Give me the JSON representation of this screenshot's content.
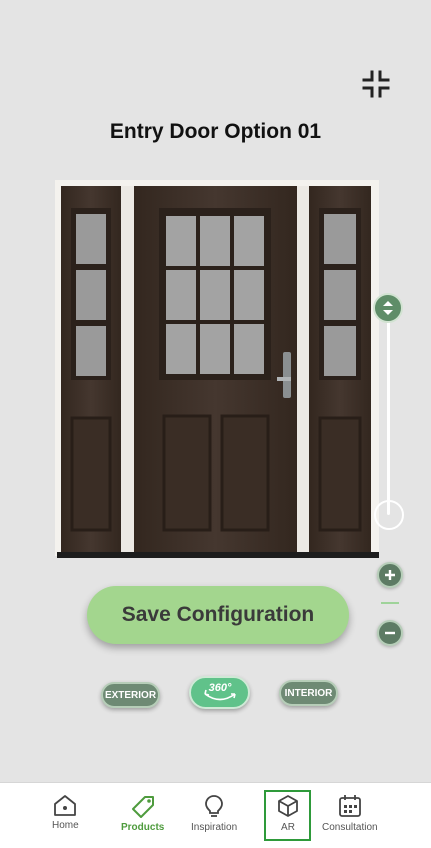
{
  "page": {
    "title": "Entry Door Option 01"
  },
  "icons": {
    "collapse": "collapse-arrows-icon",
    "rotate": "rotate-360-icon"
  },
  "actions": {
    "save_label": "Save Configuration"
  },
  "view_toggles": [
    {
      "label": "EXTERIOR",
      "active": false
    },
    {
      "label": "360°",
      "active": true
    },
    {
      "label": "INTERIOR",
      "active": false
    }
  ],
  "zoom": {
    "slider_level": 1.0
  },
  "tabs": [
    {
      "label": "Home",
      "icon": "home-icon",
      "active": false
    },
    {
      "label": "Products",
      "icon": "tag-icon",
      "active": true
    },
    {
      "label": "Inspiration",
      "icon": "lightbulb-icon",
      "active": false
    },
    {
      "label": "AR",
      "icon": "cube-icon",
      "active": false,
      "highlighted": true
    },
    {
      "label": "Consultation",
      "icon": "calendar-icon",
      "active": false
    }
  ],
  "colors": {
    "accent_green": "#a3d68e",
    "active_tab": "#4e9b3d",
    "door_brown": "#3d302b"
  }
}
